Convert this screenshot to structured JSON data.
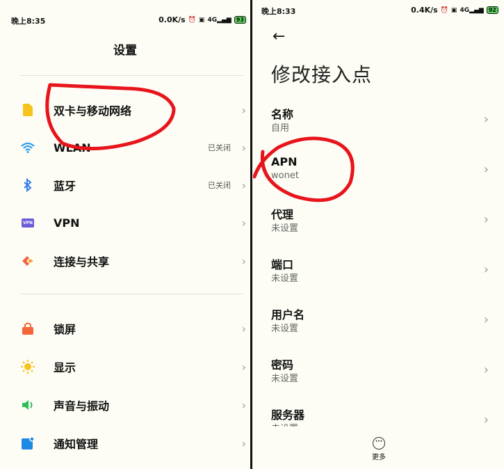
{
  "left": {
    "status_bar": {
      "time": "晚上8:35",
      "speed": "0.0K/s",
      "signal": "4G",
      "battery": "93"
    },
    "title": "设置",
    "group1": [
      {
        "label": "双卡与移动网络",
        "status": "",
        "icon": "sim-card-icon",
        "color": "#f6c21c"
      },
      {
        "label": "WLAN",
        "status": "已关闭",
        "icon": "wifi-icon",
        "color": "#2f9be8"
      },
      {
        "label": "蓝牙",
        "status": "已关闭",
        "icon": "bluetooth-icon",
        "color": "#2f7be8"
      },
      {
        "label": "VPN",
        "status": "",
        "icon": "vpn-icon",
        "color": "#6a5bd8"
      },
      {
        "label": "连接与共享",
        "status": "",
        "icon": "share-icon",
        "color": "#f0643c"
      }
    ],
    "group2": [
      {
        "label": "锁屏",
        "icon": "lock-icon",
        "color": "#f4653a"
      },
      {
        "label": "显示",
        "icon": "sun-icon",
        "color": "#f7c21c"
      },
      {
        "label": "声音与振动",
        "icon": "speaker-icon",
        "color": "#2fbd5a"
      },
      {
        "label": "通知管理",
        "icon": "notification-icon",
        "color": "#1e88e5"
      }
    ],
    "vpn_badge": "VPN"
  },
  "right": {
    "status_bar": {
      "time": "晚上8:33",
      "speed": "0.4K/s",
      "signal": "4G",
      "battery": "92"
    },
    "title": "修改接入点",
    "fields": [
      {
        "label": "名称",
        "value": "自用"
      },
      {
        "label": "APN",
        "value": "wonet"
      },
      {
        "label": "代理",
        "value": "未设置"
      },
      {
        "label": "端口",
        "value": "未设置"
      },
      {
        "label": "用户名",
        "value": "未设置"
      },
      {
        "label": "密码",
        "value": "未设置"
      },
      {
        "label": "服务器",
        "value": "未设置"
      }
    ],
    "more_label": "更多"
  },
  "colors": {
    "annotation": "#e8141b",
    "background": "#fdfdf5"
  }
}
